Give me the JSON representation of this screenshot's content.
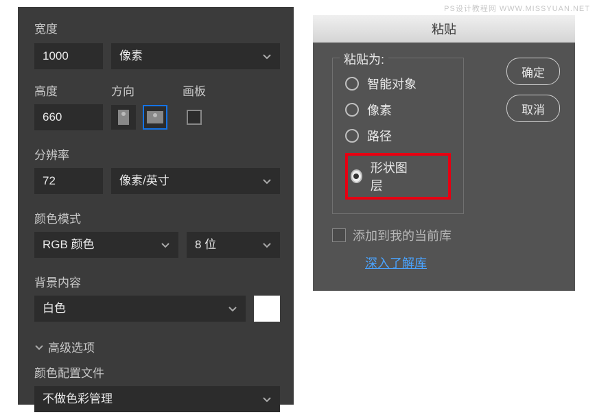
{
  "watermark": "PS设计教程网 WWW.MISSYUAN.NET",
  "left": {
    "width_label": "宽度",
    "width_value": "1000",
    "width_unit": "像素",
    "height_label": "高度",
    "height_value": "660",
    "orientation_label": "方向",
    "artboard_label": "画板",
    "resolution_label": "分辨率",
    "resolution_value": "72",
    "resolution_unit": "像素/英寸",
    "colormode_label": "颜色模式",
    "colormode_value": "RGB 颜色",
    "colordepth_value": "8 位",
    "bg_label": "背景内容",
    "bg_value": "白色",
    "advanced_label": "高级选项",
    "profile_label": "颜色配置文件",
    "profile_value": "不做色彩管理"
  },
  "right": {
    "title": "粘贴",
    "legend": "粘贴为:",
    "opt_smart": "智能对象",
    "opt_pixels": "像素",
    "opt_path": "路径",
    "opt_shape": "形状图层",
    "ok": "确定",
    "cancel": "取消",
    "add_to_lib": "添加到我的当前库",
    "learn_link": "深入了解库"
  }
}
